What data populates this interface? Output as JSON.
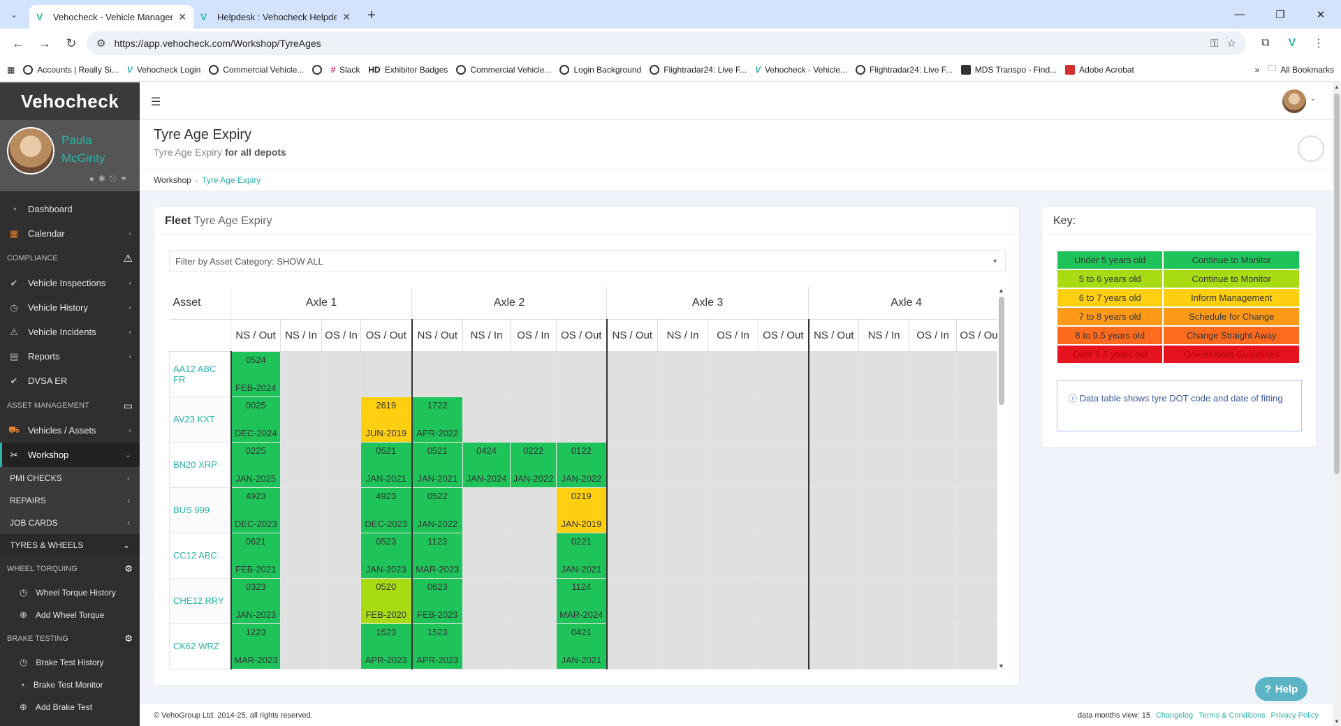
{
  "browser": {
    "tabs": [
      {
        "title": "Vehocheck - Vehicle Management"
      },
      {
        "title": "Helpdesk : Vehocheck Helpdesk"
      }
    ],
    "url": "https://app.vehocheck.com/Workshop/TyreAges",
    "bookmarks": [
      "Accounts | Really Si...",
      "Vehocheck Login",
      "Commercial Vehicle...",
      "",
      "Slack",
      "Exhibitor Badges",
      "Commercial Vehicle...",
      "Login Background",
      "Flightradar24: Live F...",
      "Vehocheck - Vehicle...",
      "Flightradar24: Live F...",
      "MDS Transpo - Find...",
      "Adobe Acrobat"
    ],
    "all_bookmarks": "All Bookmarks"
  },
  "sidebar": {
    "logo": "Vehocheck",
    "user_first": "Paula",
    "user_last": "McGinty",
    "dashboard": "Dashboard",
    "calendar": "Calendar",
    "compliance": "COMPLIANCE",
    "vehicle_inspections": "Vehicle Inspections",
    "vehicle_history": "Vehicle History",
    "vehicle_incidents": "Vehicle Incidents",
    "reports": "Reports",
    "dvsa_er": "DVSA ER",
    "asset_management": "ASSET MANAGEMENT",
    "vehicles_assets": "Vehicles / Assets",
    "workshop": "Workshop",
    "pmi_checks": "PMI CHECKS",
    "repairs": "REPAIRS",
    "job_cards": "JOB CARDS",
    "tyres_wheels": "TYRES & WHEELS",
    "wheel_torquing": "WHEEL TORQUING",
    "wheel_torque_history": "Wheel Torque History",
    "add_wheel_torque": "Add Wheel Torque",
    "brake_testing": "BRAKE TESTING",
    "brake_test_history": "Brake Test History",
    "brake_test_monitor": "Brake Test Monitor",
    "add_brake_test": "Add Brake Test"
  },
  "page": {
    "title": "Tyre Age Expiry",
    "subtitle_a": "Tyre Age Expiry",
    "subtitle_b": "for all depots",
    "crumb_1": "Workshop",
    "crumb_2": "Tyre Age Expiry"
  },
  "fleet": {
    "title_b": "Fleet",
    "title_rest": "Tyre Age Expiry",
    "filter": "Filter by Asset Category: SHOW ALL",
    "asset_header": "Asset",
    "axles": [
      "Axle 1",
      "Axle 2",
      "Axle 3",
      "Axle 4"
    ],
    "positions": [
      "NS / Out",
      "NS / In",
      "OS / In",
      "OS / Out"
    ],
    "rows": [
      {
        "asset": "AA12 ABC FR",
        "cells": [
          [
            "0524",
            "FEB-2024",
            "g"
          ],
          null,
          null,
          null,
          null,
          null,
          null,
          null,
          null,
          null,
          null,
          null,
          null,
          null,
          null,
          null
        ]
      },
      {
        "asset": "AV23 KXT",
        "cells": [
          [
            "0025",
            "DEC-2024",
            "g"
          ],
          null,
          null,
          [
            "2619",
            "JUN-2019",
            "y"
          ],
          [
            "1722",
            "APR-2022",
            "g"
          ],
          null,
          null,
          null,
          null,
          null,
          null,
          null,
          null,
          null,
          null,
          null
        ]
      },
      {
        "asset": "BN20 XRP",
        "cells": [
          [
            "0225",
            "JAN-2025",
            "g"
          ],
          null,
          null,
          [
            "0521",
            "JAN-2021",
            "g"
          ],
          [
            "0521",
            "JAN-2021",
            "g"
          ],
          [
            "0424",
            "JAN-2024",
            "g"
          ],
          [
            "0222",
            "JAN-2022",
            "g"
          ],
          [
            "0122",
            "JAN-2022",
            "g"
          ],
          null,
          null,
          null,
          null,
          null,
          null,
          null,
          null
        ]
      },
      {
        "asset": "BUS 999",
        "cells": [
          [
            "4923",
            "DEC-2023",
            "g"
          ],
          null,
          null,
          [
            "4923",
            "DEC-2023",
            "g"
          ],
          [
            "0522",
            "JAN-2022",
            "g"
          ],
          null,
          null,
          [
            "0219",
            "JAN-2019",
            "y"
          ],
          null,
          null,
          null,
          null,
          null,
          null,
          null,
          null
        ]
      },
      {
        "asset": "CC12 ABC",
        "cells": [
          [
            "0621",
            "FEB-2021",
            "g"
          ],
          null,
          null,
          [
            "0523",
            "JAN-2023",
            "g"
          ],
          [
            "1123",
            "MAR-2023",
            "g"
          ],
          null,
          null,
          [
            "0221",
            "JAN-2021",
            "g"
          ],
          null,
          null,
          null,
          null,
          null,
          null,
          null,
          null
        ]
      },
      {
        "asset": "CHE12 RRY",
        "cells": [
          [
            "0323",
            "JAN-2023",
            "g"
          ],
          null,
          null,
          [
            "0520",
            "FEB-2020",
            "lg"
          ],
          [
            "0623",
            "FEB-2023",
            "g"
          ],
          null,
          null,
          [
            "1124",
            "MAR-2024",
            "g"
          ],
          null,
          null,
          null,
          null,
          null,
          null,
          null,
          null
        ]
      },
      {
        "asset": "CK62 WRZ",
        "cells": [
          [
            "1223",
            "MAR-2023",
            "g"
          ],
          null,
          null,
          [
            "1523",
            "APR-2023",
            "g"
          ],
          [
            "1523",
            "APR-2023",
            "g"
          ],
          null,
          null,
          [
            "0421",
            "JAN-2021",
            "g"
          ],
          null,
          null,
          null,
          null,
          null,
          null,
          null,
          null
        ]
      }
    ]
  },
  "key": {
    "title": "Key:",
    "rows": [
      [
        "Under 5 years old",
        "Continue to Monitor"
      ],
      [
        "5 to 6 years old",
        "Continue to Monitor"
      ],
      [
        "6 to 7 years old",
        "Inform Management"
      ],
      [
        "7 to 8 years old",
        "Schedule for Change"
      ],
      [
        "8 to 9.5 years old",
        "Change Straight Away"
      ],
      [
        "Over 9.5 years old",
        "Government Guidelines"
      ]
    ],
    "colors": [
      "#1ec45a",
      "#a8dc12",
      "#ffcf10",
      "#ff9a18",
      "#ff6b1e",
      "#e6141e"
    ],
    "info": "Data table shows tyre DOT code and date of fitting"
  },
  "footer": {
    "copyright": "© VehoGroup Ltd. 2014-25, all rights reserved.",
    "months": "data months view: 15",
    "changelog": "Changelog",
    "terms": "Terms & Conditions",
    "privacy": "Privacy Policy"
  },
  "help": "Help"
}
